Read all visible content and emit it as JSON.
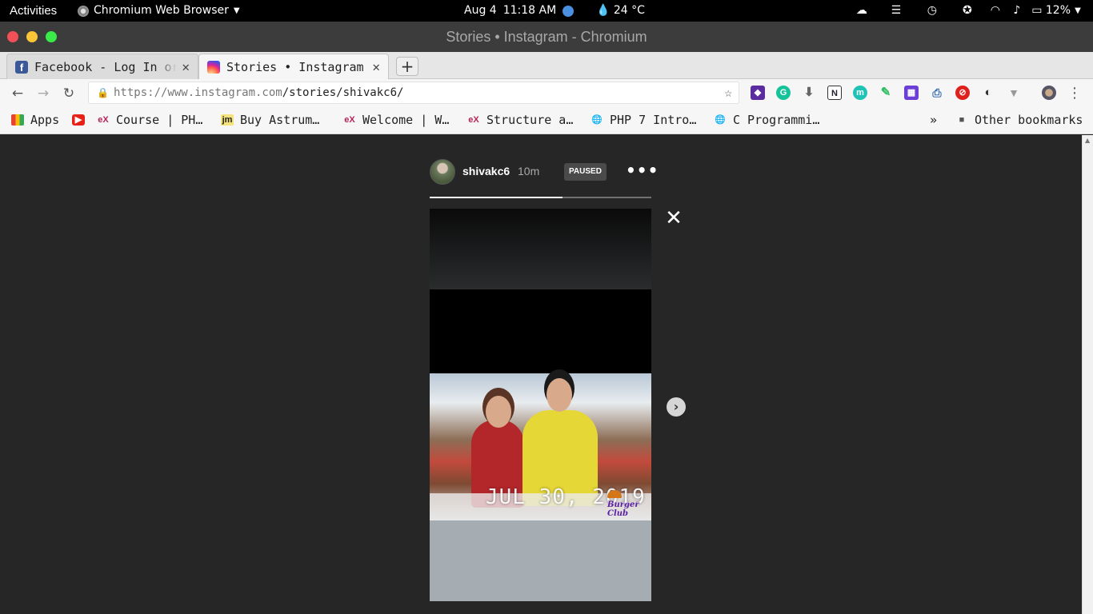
{
  "system": {
    "activities": "Activities",
    "app_name": "Chromium Web Browser",
    "date": "Aug 4",
    "time": "11:18 AM",
    "weather": "24 °C",
    "battery": "12%"
  },
  "window": {
    "title": "Stories • Instagram - Chromium"
  },
  "tabs": [
    {
      "label": "Facebook - Log In or Sign Up",
      "favicon": "facebook-icon",
      "active": false
    },
    {
      "label": "Stories • Instagram",
      "favicon": "instagram-icon",
      "active": true
    }
  ],
  "toolbar": {
    "url_host": "https://www.instagram.com",
    "url_path": "/stories/shivakc6/"
  },
  "bookmarks": {
    "items": [
      {
        "label": "Apps",
        "icon": "apps-grid-icon"
      },
      {
        "label": "",
        "icon": "youtube-icon"
      },
      {
        "label": "Course | PH…",
        "icon": "edx-icon"
      },
      {
        "label": "Buy Astrum…",
        "icon": "jm-icon"
      },
      {
        "label": "Welcome | W…",
        "icon": "edx-icon"
      },
      {
        "label": "Structure a…",
        "icon": "edx-icon"
      },
      {
        "label": "PHP 7 Intro…",
        "icon": "globe-icon"
      },
      {
        "label": "C Programmi…",
        "icon": "globe-icon"
      }
    ],
    "overflow": "»",
    "other": "Other bookmarks"
  },
  "story": {
    "username": "shivakc6",
    "time_ago": "10m",
    "status_badge": "PAUSED",
    "progress_fraction": 0.6,
    "photo_date_stamp": "JUL 30, 2019",
    "photo_logo_text": "Burger Club"
  },
  "colors": {
    "page_bg": "#262626",
    "progress": "#ffffff"
  }
}
